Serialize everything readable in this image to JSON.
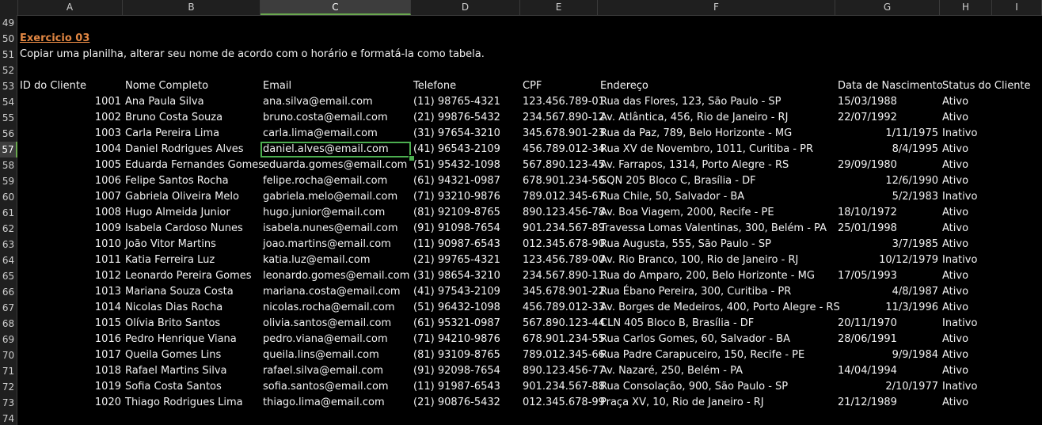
{
  "columns": [
    "A",
    "B",
    "C",
    "D",
    "E",
    "F",
    "G",
    "H",
    "I"
  ],
  "selected_column": "C",
  "selected_row": 57,
  "row_numbers": [
    49,
    50,
    51,
    52,
    53,
    54,
    55,
    56,
    57,
    58,
    59,
    60,
    61,
    62,
    63,
    64,
    65,
    66,
    67,
    68,
    69,
    70,
    71,
    72,
    73,
    74
  ],
  "title": "Exercicio 03",
  "instruction": "Copiar uma planilha, alterar seu nome de acordo com o horário e formatá-la como tabela.",
  "headers": [
    "ID do Cliente",
    "Nome Completo",
    "Email",
    "Telefone",
    "CPF",
    "Endereço",
    "Data de Nascimento",
    "Status do Cliente"
  ],
  "rows": [
    {
      "id": "1001",
      "name": "Ana Paula Silva",
      "email": "ana.silva@email.com",
      "phone": "(11) 98765-4321",
      "cpf": "123.456.789-01",
      "address": "Rua das Flores, 123, São Paulo - SP",
      "birth": "15/03/1988",
      "birth_right": false,
      "status": "Ativo"
    },
    {
      "id": "1002",
      "name": "Bruno Costa Souza",
      "email": "bruno.costa@email.com",
      "phone": "(21) 99876-5432",
      "cpf": "234.567.890-12",
      "address": "Av. Atlântica, 456, Rio de Janeiro - RJ",
      "birth": "22/07/1992",
      "birth_right": false,
      "status": "Ativo"
    },
    {
      "id": "1003",
      "name": "Carla Pereira Lima",
      "email": "carla.lima@email.com",
      "phone": "(31) 97654-3210",
      "cpf": "345.678.901-23",
      "address": "Rua da Paz, 789, Belo Horizonte - MG",
      "birth": "1/11/1975",
      "birth_right": true,
      "status": "Inativo"
    },
    {
      "id": "1004",
      "name": "Daniel Rodrigues Alves",
      "email": "daniel.alves@email.com",
      "phone": "(41) 96543-2109",
      "cpf": "456.789.012-34",
      "address": "Rua XV de Novembro, 1011, Curitiba - PR",
      "birth": "8/4/1995",
      "birth_right": true,
      "status": "Ativo"
    },
    {
      "id": "1005",
      "name": "Eduarda Fernandes Gomes",
      "email": "eduarda.gomes@email.com",
      "phone": "(51) 95432-1098",
      "cpf": "567.890.123-45",
      "address": "Av. Farrapos, 1314, Porto Alegre - RS",
      "birth": "29/09/1980",
      "birth_right": false,
      "status": "Ativo"
    },
    {
      "id": "1006",
      "name": "Felipe Santos Rocha",
      "email": "felipe.rocha@email.com",
      "phone": "(61) 94321-0987",
      "cpf": "678.901.234-56",
      "address": "SQN 205 Bloco C, Brasília - DF",
      "birth": "12/6/1990",
      "birth_right": true,
      "status": "Ativo"
    },
    {
      "id": "1007",
      "name": "Gabriela Oliveira Melo",
      "email": "gabriela.melo@email.com",
      "phone": "(71) 93210-9876",
      "cpf": "789.012.345-67",
      "address": "Rua Chile, 50, Salvador - BA",
      "birth": "5/2/1983",
      "birth_right": true,
      "status": "Inativo"
    },
    {
      "id": "1008",
      "name": "Hugo Almeida Junior",
      "email": "hugo.junior@email.com",
      "phone": "(81) 92109-8765",
      "cpf": "890.123.456-78",
      "address": "Av. Boa Viagem, 2000, Recife - PE",
      "birth": "18/10/1972",
      "birth_right": false,
      "status": "Ativo"
    },
    {
      "id": "1009",
      "name": "Isabela Cardoso Nunes",
      "email": "isabela.nunes@email.com",
      "phone": "(91) 91098-7654",
      "cpf": "901.234.567-89",
      "address": "Travessa Lomas Valentinas, 300, Belém - PA",
      "birth": "25/01/1998",
      "birth_right": false,
      "status": "Ativo"
    },
    {
      "id": "1010",
      "name": "João Vitor Martins",
      "email": "joao.martins@email.com",
      "phone": "(11) 90987-6543",
      "cpf": "012.345.678-90",
      "address": "Rua Augusta, 555, São Paulo - SP",
      "birth": "3/7/1985",
      "birth_right": true,
      "status": "Ativo"
    },
    {
      "id": "1011",
      "name": "Katia Ferreira Luz",
      "email": "katia.luz@email.com",
      "phone": "(21) 99765-4321",
      "cpf": "123.456.789-00",
      "address": "Av. Rio Branco, 100, Rio de Janeiro - RJ",
      "birth": "10/12/1979",
      "birth_right": true,
      "status": "Inativo"
    },
    {
      "id": "1012",
      "name": "Leonardo Pereira Gomes",
      "email": "leonardo.gomes@email.com",
      "phone": "(31) 98654-3210",
      "cpf": "234.567.890-11",
      "address": "Rua do Amparo, 200, Belo Horizonte - MG",
      "birth": "17/05/1993",
      "birth_right": false,
      "status": "Ativo"
    },
    {
      "id": "1013",
      "name": "Mariana Souza Costa",
      "email": "mariana.costa@email.com",
      "phone": "(41) 97543-2109",
      "cpf": "345.678.901-22",
      "address": "Rua Ébano Pereira, 300, Curitiba - PR",
      "birth": "4/8/1987",
      "birth_right": true,
      "status": "Ativo"
    },
    {
      "id": "1014",
      "name": "Nicolas Dias Rocha",
      "email": "nicolas.rocha@email.com",
      "phone": "(51) 96432-1098",
      "cpf": "456.789.012-33",
      "address": "Av. Borges de Medeiros, 400, Porto Alegre - RS",
      "birth": "11/3/1996",
      "birth_right": true,
      "status": "Ativo"
    },
    {
      "id": "1015",
      "name": "Olívia Brito Santos",
      "email": "olivia.santos@email.com",
      "phone": "(61) 95321-0987",
      "cpf": "567.890.123-44",
      "address": "CLN 405 Bloco B, Brasília - DF",
      "birth": "20/11/1970",
      "birth_right": false,
      "status": "Inativo"
    },
    {
      "id": "1016",
      "name": "Pedro Henrique Viana",
      "email": "pedro.viana@email.com",
      "phone": "(71) 94210-9876",
      "cpf": "678.901.234-55",
      "address": "Rua Carlos Gomes, 60, Salvador - BA",
      "birth": "28/06/1991",
      "birth_right": false,
      "status": "Ativo"
    },
    {
      "id": "1017",
      "name": "Queila Gomes Lins",
      "email": "queila.lins@email.com",
      "phone": "(81) 93109-8765",
      "cpf": "789.012.345-66",
      "address": "Rua Padre Carapuceiro, 150, Recife - PE",
      "birth": "9/9/1984",
      "birth_right": true,
      "status": "Ativo"
    },
    {
      "id": "1018",
      "name": "Rafael Martins Silva",
      "email": "rafael.silva@email.com",
      "phone": "(91) 92098-7654",
      "cpf": "890.123.456-77",
      "address": "Av. Nazaré, 250, Belém - PA",
      "birth": "14/04/1994",
      "birth_right": false,
      "status": "Ativo"
    },
    {
      "id": "1019",
      "name": "Sofia Costa Santos",
      "email": "sofia.santos@email.com",
      "phone": "(11) 91987-6543",
      "cpf": "901.234.567-88",
      "address": "Rua Consolação, 900, São Paulo - SP",
      "birth": "2/10/1977",
      "birth_right": true,
      "status": "Inativo"
    },
    {
      "id": "1020",
      "name": "Thiago Rodrigues Lima",
      "email": "thiago.lima@email.com",
      "phone": "(21) 90876-5432",
      "cpf": "012.345.678-99",
      "address": "Praça XV, 10, Rio de Janeiro - RJ",
      "birth": "21/12/1989",
      "birth_right": false,
      "status": "Ativo"
    }
  ]
}
